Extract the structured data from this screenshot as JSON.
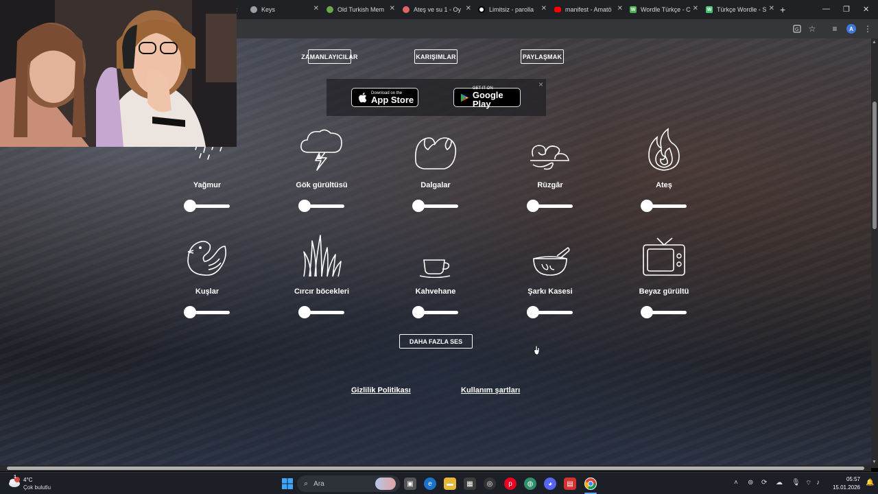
{
  "browser": {
    "tabs": [
      {
        "title": "Keys",
        "favicon": "globe-icon",
        "color": "#9aa0a6"
      },
      {
        "title": "Old Turkish Mem",
        "favicon": "game-icon",
        "color": "#6aa84f"
      },
      {
        "title": "Ateş ve su 1 - Oy",
        "favicon": "game-icon",
        "color": "#e06666"
      },
      {
        "title": "Limitsiz - parolla",
        "favicon": "clock-icon",
        "color": "#ffffff"
      },
      {
        "title": "manifest - Amatö",
        "favicon": "youtube-icon",
        "color": "#ff0000"
      },
      {
        "title": "Wordle Türkçe - C",
        "favicon": "w-icon",
        "color": "#4caf50"
      },
      {
        "title": "Türkçe Wordle - S",
        "favicon": "w-icon",
        "color": "#3ec46d"
      }
    ],
    "favicon_letter": "W",
    "new_tab": "+",
    "profile_initial": "A"
  },
  "nav": {
    "timers": "ZAMANLAYICILAR",
    "mixes": "KARIŞIMLAR",
    "share": "PAYLAŞMAK"
  },
  "banner": {
    "appstore_small": "Download on the",
    "appstore_big": "App Store",
    "googleplay_small": "GET IT ON",
    "googleplay_big": "Google Play",
    "close": "×"
  },
  "sounds": [
    {
      "label": "Yağmur",
      "icon": "rain-icon",
      "volume": 0
    },
    {
      "label": "Gök gürültüsü",
      "icon": "thunder-icon",
      "volume": 0
    },
    {
      "label": "Dalgalar",
      "icon": "waves-icon",
      "volume": 0
    },
    {
      "label": "Rüzgâr",
      "icon": "wind-icon",
      "volume": 0
    },
    {
      "label": "Ateş",
      "icon": "fire-icon",
      "volume": 0
    },
    {
      "label": "Kuşlar",
      "icon": "bird-icon",
      "volume": 0
    },
    {
      "label": "Cırcır böcekleri",
      "icon": "grass-icon",
      "volume": 0
    },
    {
      "label": "Kahvehane",
      "icon": "coffee-icon",
      "volume": 0
    },
    {
      "label": "Şarkı Kasesi",
      "icon": "singing-bowl-icon",
      "volume": 0
    },
    {
      "label": "Beyaz gürültü",
      "icon": "tv-icon",
      "volume": 0
    }
  ],
  "more_sounds": "DAHA FAZLA SES",
  "footer": {
    "privacy": "Gizlilik Politikası",
    "terms": "Kullanım şartları"
  },
  "taskbar": {
    "weather_temp": "4°C",
    "weather_desc": "Çok bulutlu",
    "search_placeholder": "Ara",
    "time": "05:57",
    "date": "15.01.2026",
    "notification_badge": "1"
  },
  "colors": {
    "page_text": "#ffffff",
    "tabstrip": "#202124",
    "toolbar": "#35363a",
    "taskbar": "#1c1f26"
  }
}
